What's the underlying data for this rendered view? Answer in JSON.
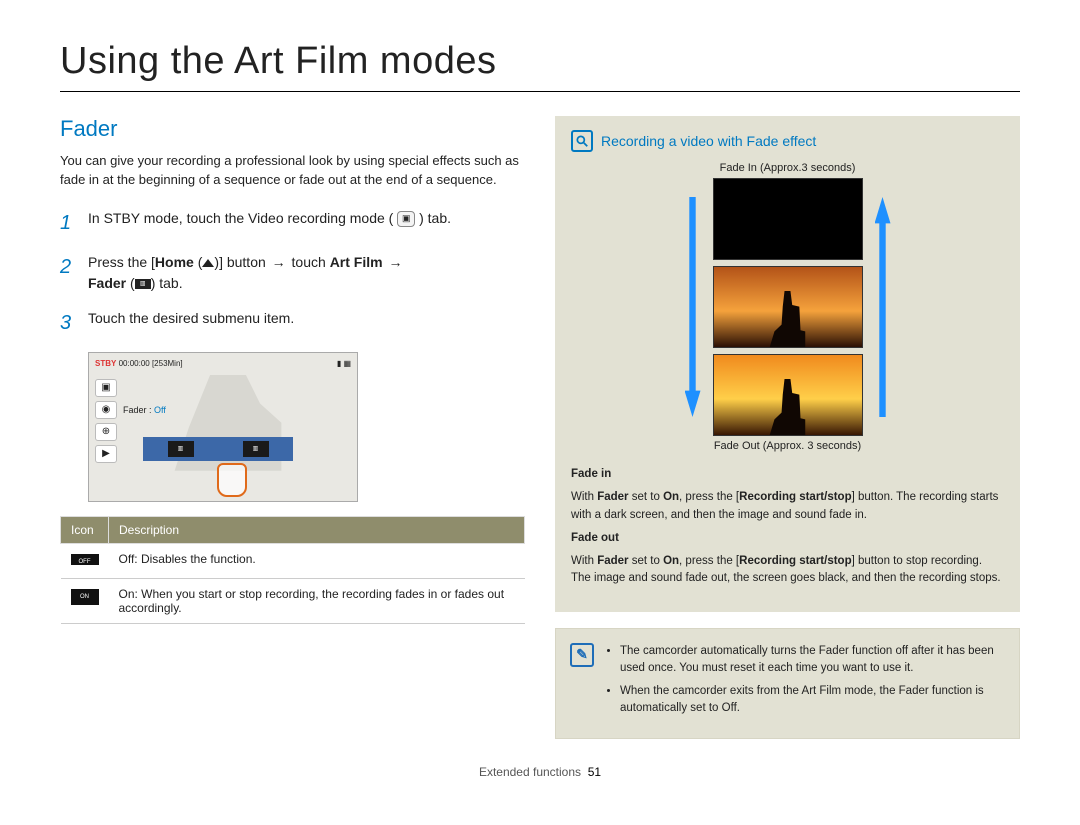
{
  "page_title": "Using the Art Film modes",
  "section_heading": "Fader",
  "intro": "You can give your recording a professional look by using special effects such as fade in at the beginning of a sequence or fade out at the end of a sequence.",
  "steps": {
    "s1_a": "In STBY mode, touch the Video recording mode (",
    "s1_b": ") tab.",
    "s2_a": "Press the [",
    "s2_home": "Home",
    "s2_b": "] button ",
    "s2_c": " touch ",
    "s2_artfilm": "Art Film",
    "s2_d": " ",
    "s2_fader": "Fader",
    "s2_e": " (",
    "s2_f": ") tab.",
    "s3": "Touch the desired submenu item."
  },
  "lcd": {
    "stby": "STBY",
    "time": "00:00:00 [253Min]",
    "fader_label": "Fader : ",
    "fader_value": "Off"
  },
  "table": {
    "h_icon": "Icon",
    "h_desc": "Description",
    "rows": [
      {
        "icon": "OFF",
        "bold": "Off",
        "rest": ": Disables the function."
      },
      {
        "icon": "ON",
        "bold": "On",
        "rest": ": When you start or stop recording, the recording fades in or fades out accordingly."
      }
    ]
  },
  "note": {
    "title": "Recording a video with Fade effect",
    "fade_in_caption": "Fade In (Approx.3 seconds)",
    "fade_out_caption": "Fade Out (Approx. 3 seconds)",
    "fade_in_head": "Fade in",
    "fade_in_body_a": "With ",
    "fade_in_body_b": " set to ",
    "fade_in_body_c": ", press the [",
    "fade_in_body_d": "] button. The recording starts with a dark screen, and then the image and sound fade in.",
    "fade_out_head": "Fade out",
    "fade_out_body_a": "With ",
    "fade_out_body_b": " set to ",
    "fade_out_body_c": ", press the [",
    "fade_out_body_d": "] button to stop recording. The image and sound fade out, the screen goes black, and then the recording stops.",
    "term_fader": "Fader",
    "term_on": "On",
    "term_rec": "Recording start/stop"
  },
  "info_bullets": [
    "The camcorder automatically turns the Fader function off after it has been used once. You must reset it each time you want to use it.",
    "When the camcorder exits from the Art Film mode, the Fader function is automatically set to "
  ],
  "info_off": "Off",
  "info_period": ".",
  "footer_section": "Extended functions",
  "footer_page": "51"
}
